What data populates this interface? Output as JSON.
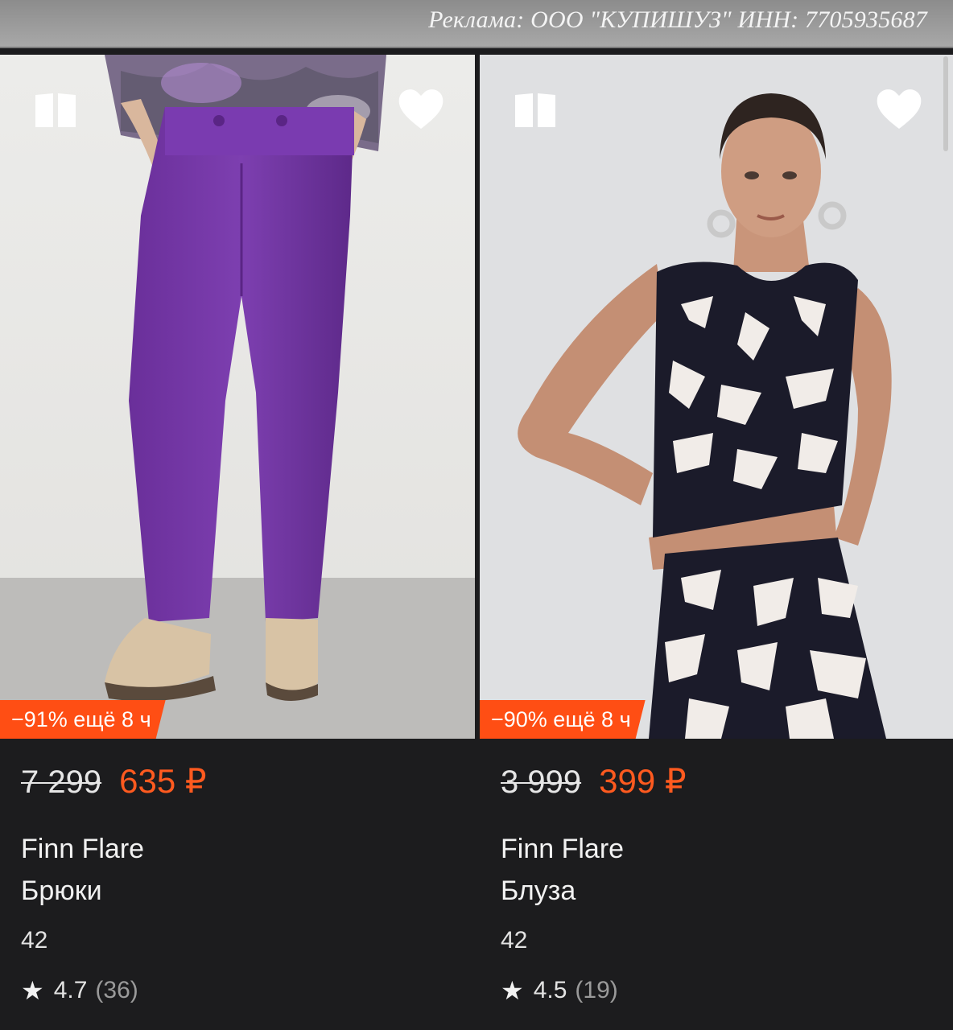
{
  "ad": {
    "text": "Реклама: ООО \"КУПИШУЗ\" ИНН: 7705935687"
  },
  "products": [
    {
      "badge": "−91% ещё 8 ч",
      "old_price": "7 299",
      "new_price": "635 ₽",
      "brand": "Finn Flare",
      "name": "Брюки",
      "size": "42",
      "rating": "4.7",
      "reviews": "(36)",
      "image": "purple-trousers-photo"
    },
    {
      "badge": "−90% ещё 8 ч",
      "old_price": "3 999",
      "new_price": "399 ₽",
      "brand": "Finn Flare",
      "name": "Блуза",
      "size": "42",
      "rating": "4.5",
      "reviews": "(19)",
      "image": "printed-top-photo"
    }
  ],
  "icons": {
    "compare": "compare-icon",
    "favorite": "heart-icon",
    "rating": "star-icon"
  },
  "colors": {
    "accent": "#ff4e14",
    "price": "#ff5a1f",
    "background": "#1c1c1e"
  }
}
